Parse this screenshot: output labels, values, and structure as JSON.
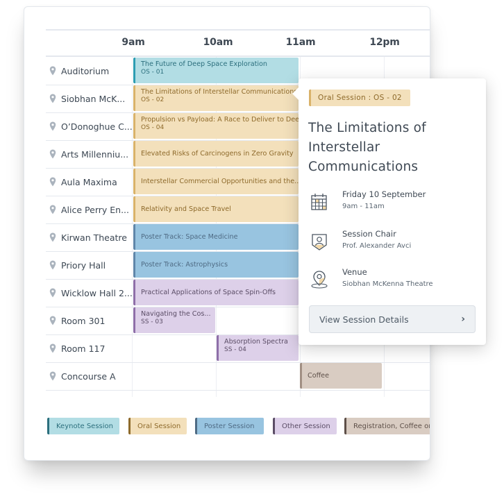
{
  "timeline": {
    "hours": [
      "9am",
      "10am",
      "11am",
      "12pm"
    ]
  },
  "rooms": [
    {
      "name": "Auditorium"
    },
    {
      "name": "Siobhan McK..."
    },
    {
      "name": "O’Donoghue C..."
    },
    {
      "name": "Arts Millenniu..."
    },
    {
      "name": "Aula Maxima"
    },
    {
      "name": "Alice Perry En..."
    },
    {
      "name": "Kirwan Theatre"
    },
    {
      "name": "Priory Hall"
    },
    {
      "name": "Wicklow Hall 2..."
    },
    {
      "name": "Room 301"
    },
    {
      "name": "Room 117"
    },
    {
      "name": "Concourse A"
    }
  ],
  "sessions": [
    {
      "room": 0,
      "type": "keynote",
      "title": "The Future of Deep Space Exploration",
      "code": "OS - 01",
      "start": 9,
      "end": 11
    },
    {
      "room": 1,
      "type": "oral",
      "title": "The Limitations of Interstellar Communications",
      "code": "OS - 02",
      "start": 9,
      "end": 11
    },
    {
      "room": 2,
      "type": "oral",
      "title": "Propulsion vs Payload: A Race to Deliver to Deep",
      "code": "OS - 04",
      "start": 9,
      "end": 11
    },
    {
      "room": 3,
      "type": "oral",
      "title": "Elevated Risks of Carcinogens in Zero Gravity",
      "code": "",
      "start": 9,
      "end": 11
    },
    {
      "room": 4,
      "type": "oral",
      "title": "Interstellar Commercial Opportunities and the..",
      "code": "",
      "start": 9,
      "end": 11
    },
    {
      "room": 5,
      "type": "oral",
      "title": "Relativity and Space Travel",
      "code": "",
      "start": 9,
      "end": 11
    },
    {
      "room": 6,
      "type": "poster",
      "title": "Poster Track: Space Medicine",
      "code": "",
      "start": 9,
      "end": 11
    },
    {
      "room": 7,
      "type": "poster",
      "title": "Poster Track: Astrophysics",
      "code": "",
      "start": 9,
      "end": 11
    },
    {
      "room": 8,
      "type": "other",
      "title": "Practical Applications of Space Spin-Offs",
      "code": "",
      "start": 9,
      "end": 11
    },
    {
      "room": 9,
      "type": "other",
      "title": "Navigating the Cos...",
      "code": "SS - 03",
      "start": 9,
      "end": 10
    },
    {
      "room": 10,
      "type": "other",
      "title": "Absorption Spectra",
      "code": "SS - 04",
      "start": 10,
      "end": 11
    },
    {
      "room": 11,
      "type": "registration",
      "title": "Coffee",
      "code": "",
      "start": 11,
      "end": 12
    }
  ],
  "legend": [
    {
      "type": "keynote",
      "label": "Keynote Session"
    },
    {
      "type": "oral",
      "label": "Oral Session"
    },
    {
      "type": "poster",
      "label": "Poster Session"
    },
    {
      "type": "other",
      "label": "Other Session"
    },
    {
      "type": "registration",
      "label": "Registration, Coffee or Lunch"
    }
  ],
  "colors": {
    "keynote": "#b2dde4",
    "oral": "#f3e0bb",
    "poster": "#98c4e0",
    "other": "#ddd0e9",
    "registration": "#d9ccc2"
  },
  "popover": {
    "badge": "Oral Session : OS - 02",
    "title": "The Limitations of Interstellar Communications",
    "date_label": "Friday 10 September",
    "time_range": "9am - 11am",
    "chair_label": "Session Chair",
    "chair_name": "Prof. Alexander Avci",
    "venue_label": "Venue",
    "venue_name": "Siobhan McKenna Theatre",
    "button_label": "View Session Details",
    "icons": {
      "date": "calendar-icon",
      "chair": "person-badge-icon",
      "venue": "map-pin-icon",
      "button": "chevron-right-icon"
    }
  }
}
